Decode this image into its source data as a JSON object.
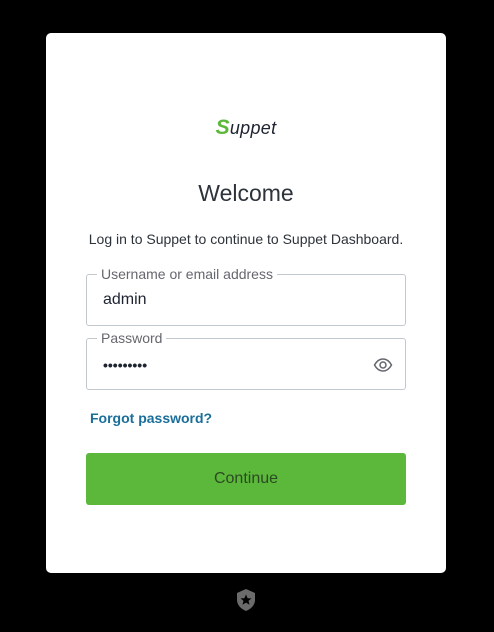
{
  "logo": {
    "initial": "S",
    "rest": "uppet"
  },
  "header": {
    "title": "Welcome",
    "subtitle": "Log in to Suppet to continue to Suppet Dashboard."
  },
  "form": {
    "username": {
      "label": "Username or email address",
      "value": "admin"
    },
    "password": {
      "label": "Password",
      "value": "•••••••••",
      "toggle_icon": "eye-icon"
    },
    "forgot_label": "Forgot password?",
    "continue_label": "Continue"
  },
  "footer": {
    "badge_icon": "shield-star-icon"
  },
  "colors": {
    "accent": "#5bb83a",
    "link": "#1a6e9a",
    "background": "#000000",
    "card": "#ffffff"
  }
}
